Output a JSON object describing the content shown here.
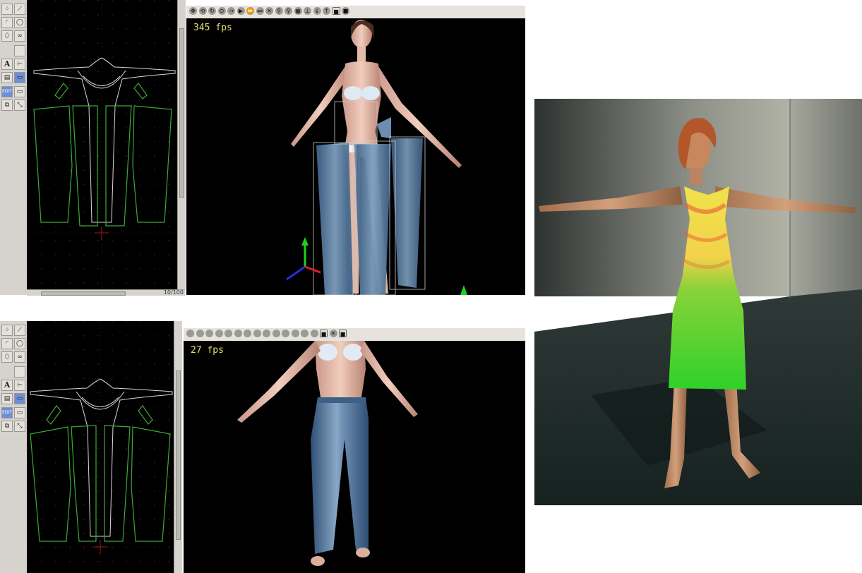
{
  "top_editor": {
    "fps_label": "345 fps",
    "frame_counter": "10/100",
    "toolbar_icons": [
      "move-icon",
      "rotate-icon",
      "cycle-icon",
      "reset-icon",
      "arrow-right-icon",
      "play-icon",
      "fast-forward-icon",
      "skip-icon",
      "close-icon",
      "walk-icon",
      "run-icon",
      "grid-icon",
      "pin-icon",
      "arrow-down-icon",
      "arrow-up-icon",
      "record-icon",
      "stop-icon"
    ]
  },
  "bottom_editor": {
    "fps_label": "27 fps",
    "toolbar_icons": [
      "sim-icon",
      "sim-icon",
      "sim-icon",
      "sim-icon",
      "sim-icon",
      "sim-icon",
      "sim-icon",
      "sim-icon",
      "sim-icon",
      "sim-icon",
      "sim-icon",
      "sim-icon",
      "sim-icon",
      "sim-icon",
      "stop-icon",
      "close-icon",
      "record-icon"
    ]
  },
  "tool_palette": {
    "text_tool_label": "A",
    "items": [
      "points-icon",
      "line-icon",
      "curve-icon",
      "circle-icon",
      "ellipse-icon",
      "symmetry-icon",
      "blank-icon",
      "text-tool-icon",
      "seam-icon",
      "layer-icon",
      "window-icon",
      "edit-icon",
      "measure-icon",
      "duplicate-icon",
      "transform-icon"
    ]
  },
  "colors": {
    "canvas": "#000000",
    "pattern_green": "#3fa83a",
    "pattern_white": "#d8d8d8",
    "fps_yellow": "#e6e070",
    "toolbar_gray": "#d6d3ce",
    "dress_green": "#2fd12a",
    "dress_yellow": "#f0e24a"
  }
}
